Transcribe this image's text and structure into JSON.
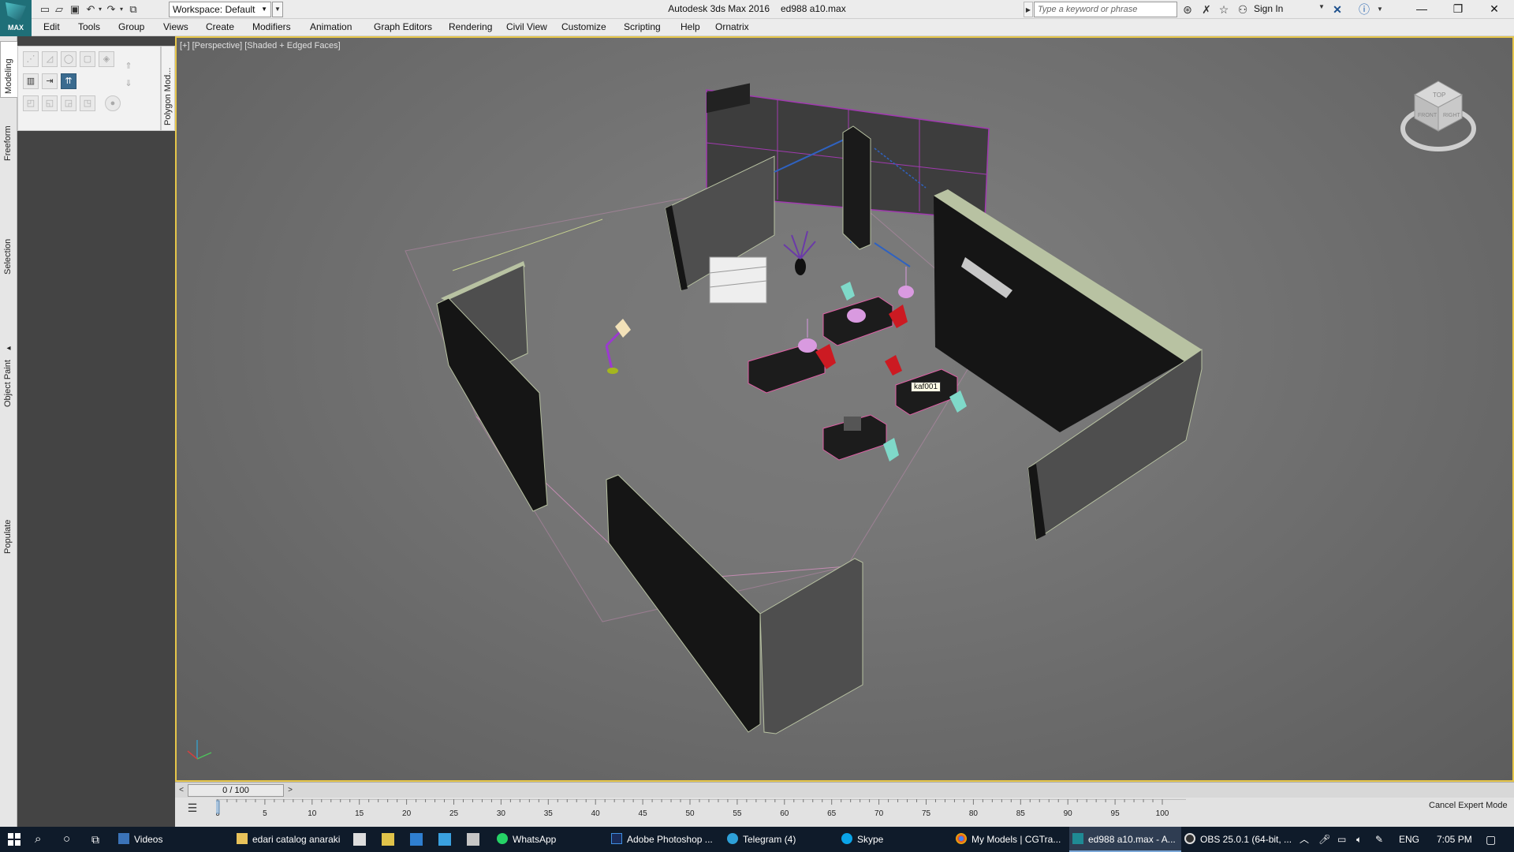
{
  "titlebar": {
    "app_name": "Autodesk 3ds Max 2016",
    "file_name": "ed988 a10.max",
    "logo_text": "MAX",
    "workspace_label": "Workspace: Default",
    "search_placeholder": "Type a keyword or phrase",
    "sign_in": "Sign In",
    "icons": [
      "new-file-icon",
      "open-file-icon",
      "save-icon",
      "undo-icon",
      "redo-icon",
      "project-folder-icon",
      "binoculars-icon",
      "exchange-icon",
      "favorites-star-icon",
      "user-icon",
      "autodesk-x-icon",
      "help-icon"
    ],
    "window_controls": [
      "minimize",
      "restore",
      "close"
    ]
  },
  "menu": [
    "Edit",
    "Tools",
    "Group",
    "Views",
    "Create",
    "Modifiers",
    "Animation",
    "Graph Editors",
    "Rendering",
    "Civil View",
    "Customize",
    "Scripting",
    "Help",
    "Ornatrix"
  ],
  "left_tabs": [
    "Modeling",
    "Freeform",
    "Selection",
    "Object Paint",
    "Populate"
  ],
  "ribbon": {
    "panel_label": "Polygon Mod...",
    "buttons_row1": [
      "vertex-icon",
      "edge-icon",
      "border-icon",
      "polygon-icon",
      "element-icon"
    ],
    "buttons_row2": [
      "modify-mode-icon",
      "edit-mode-icon",
      "stack-mode-icon"
    ],
    "side_buttons": [
      "up-arrow-icon",
      "down-arrow-icon"
    ],
    "buttons_row3": [
      "preview-off-icon",
      "preview-sub-icon",
      "preview-multi-icon",
      "ignore-back-icon",
      "use-nurms-icon"
    ]
  },
  "viewport": {
    "label": "[+] [Perspective] [Shaded + Edged Faces]",
    "tooltip": "kaf001",
    "viewcube_faces": [
      "TOP",
      "FRONT",
      "RIGHT"
    ],
    "colors": {
      "selection_border": "#e6c64a",
      "wall_dark": "#151515",
      "wall_face": "#4e4e4e",
      "wall_edge": "#b8c2a2",
      "chair_red": "#cc1a22",
      "chair_cyan": "#7fd9c9",
      "lamp_pink": "#d99ae0",
      "glass_frame": "#2f62c0",
      "window_grid": "#a13ab0"
    }
  },
  "timeline": {
    "frame_display": "0 / 100",
    "prev": "<",
    "next": ">",
    "ticks": [
      0,
      5,
      10,
      15,
      20,
      25,
      30,
      35,
      40,
      45,
      50,
      55,
      60,
      65,
      70,
      75,
      80,
      85,
      90,
      95,
      100
    ],
    "cancel_expert": "Cancel Expert Mode"
  },
  "taskbar": {
    "items": [
      {
        "label": "Videos",
        "icon": "folder-icon"
      },
      {
        "label": "edari catalog anaraki",
        "icon": "folder-icon"
      },
      {
        "label": "WhatsApp",
        "icon": "whatsapp-icon"
      },
      {
        "label": "Adobe Photoshop ...",
        "icon": "photoshop-icon"
      },
      {
        "label": "Telegram (4)",
        "icon": "telegram-icon"
      },
      {
        "label": "Skype",
        "icon": "skype-icon"
      },
      {
        "label": "My Models | CGTra...",
        "icon": "chrome-icon"
      },
      {
        "label": "ed988 a10.max - A...",
        "icon": "3dsmax-icon"
      },
      {
        "label": "OBS 25.0.1 (64-bit, ...",
        "icon": "obs-icon"
      }
    ],
    "language": "ENG",
    "time": "7:05 PM"
  }
}
